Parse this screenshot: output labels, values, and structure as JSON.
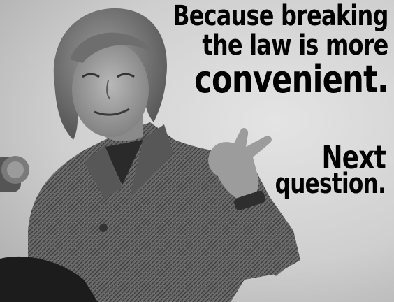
{
  "meme": {
    "caption_top": {
      "line1": "Because breaking",
      "line2": "the law is more",
      "line3": "convenient."
    },
    "caption_bottom": {
      "line1": "Next",
      "line2": "question."
    }
  },
  "colors": {
    "background": "#d6d6d6",
    "text": "#000000"
  }
}
